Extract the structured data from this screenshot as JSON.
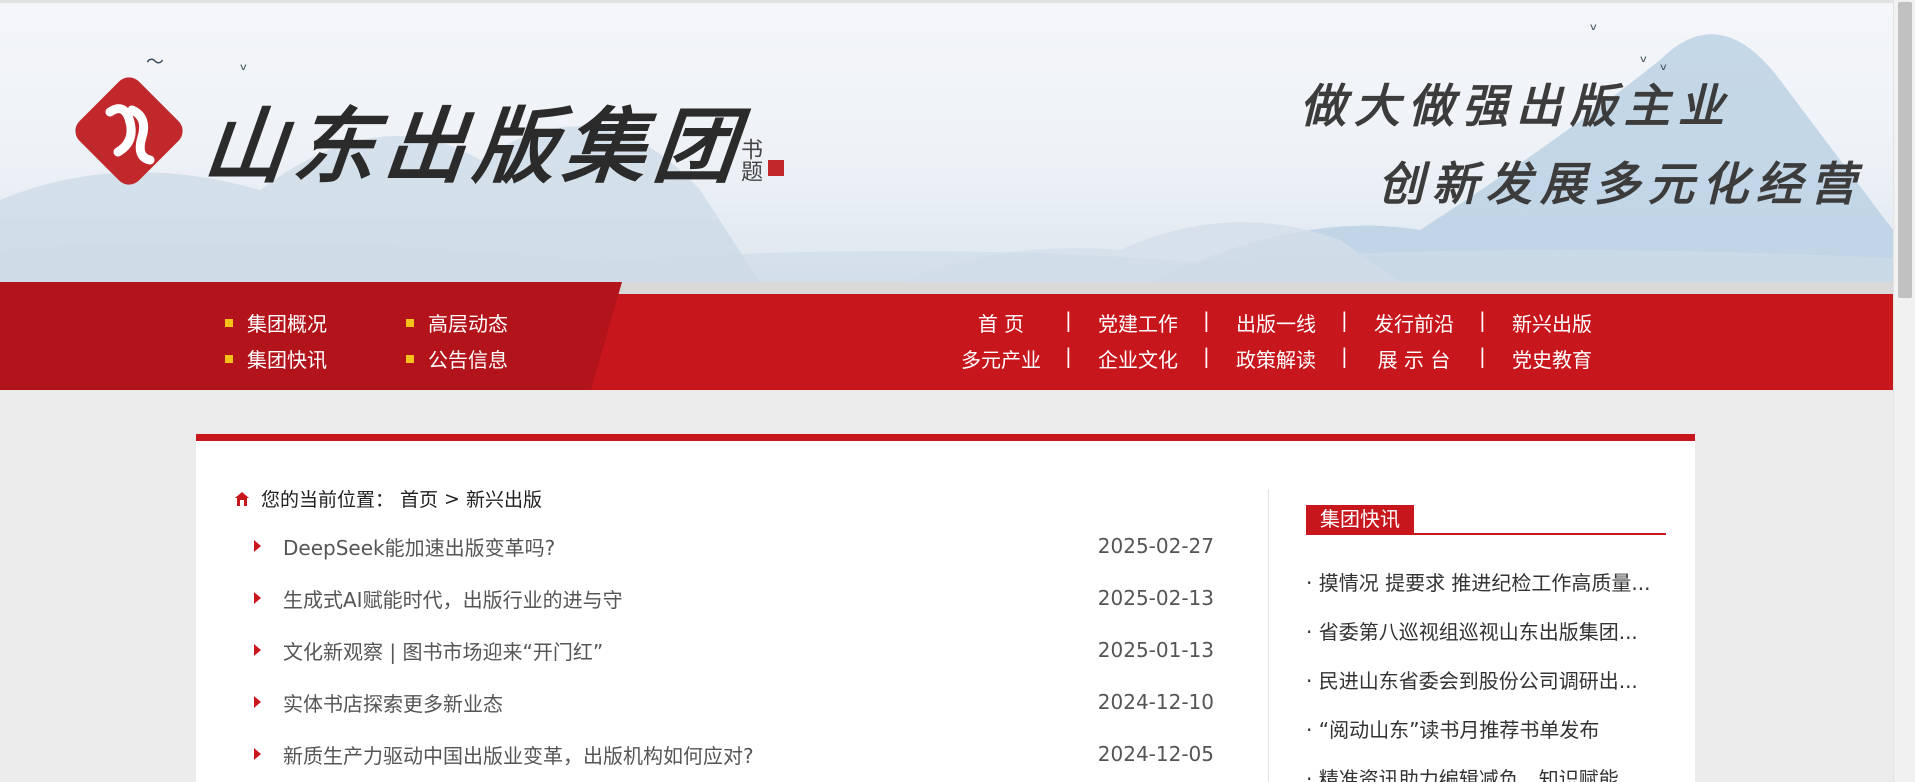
{
  "banner": {
    "logo_text": "山东出版集团",
    "signature": "书题",
    "slogan_line1": "做大做强出版主业",
    "slogan_line2": "创新发展多元化经营"
  },
  "colors": {
    "accent": "#c8161d",
    "dot": "#f4c21a"
  },
  "subnav": {
    "items": [
      {
        "label": "集团概况"
      },
      {
        "label": "高层动态"
      },
      {
        "label": "集团快讯"
      },
      {
        "label": "公告信息"
      }
    ]
  },
  "mainnav": {
    "row1": [
      {
        "label": "首  页"
      },
      {
        "label": "党建工作"
      },
      {
        "label": "出版一线"
      },
      {
        "label": "发行前沿"
      },
      {
        "label": "新兴出版"
      }
    ],
    "row2": [
      {
        "label": "多元产业"
      },
      {
        "label": "企业文化"
      },
      {
        "label": "政策解读"
      },
      {
        "label": "展 示 台"
      },
      {
        "label": "党史教育"
      }
    ],
    "separator": "|"
  },
  "breadcrumb": {
    "prefix": "您的当前位置：",
    "home": "首页",
    "sep": ">",
    "current": "新兴出版",
    "icon": "home-icon"
  },
  "articles": [
    {
      "title": "DeepSeek能加速出版变革吗?",
      "date": "2025-02-27"
    },
    {
      "title": "生成式AI赋能时代，出版行业的进与守",
      "date": "2025-02-13"
    },
    {
      "title": "文化新观察 | 图书市场迎来“开门红”",
      "date": "2025-01-13"
    },
    {
      "title": "实体书店探索更多新业态",
      "date": "2024-12-10"
    },
    {
      "title": "新质生产力驱动中国出版业变革，出版机构如何应对?",
      "date": "2024-12-05"
    }
  ],
  "sidebar": {
    "heading": "集团快讯",
    "items": [
      "· 摸情况 提要求 推进纪检工作高质量...",
      "· 省委第八巡视组巡视山东出版集团...",
      "· 民进山东省委会到股份公司调研出...",
      "· “阅动山东”读书月推荐书单发布",
      "· 精准资讯助力编辑减负、知识赋能..."
    ]
  }
}
